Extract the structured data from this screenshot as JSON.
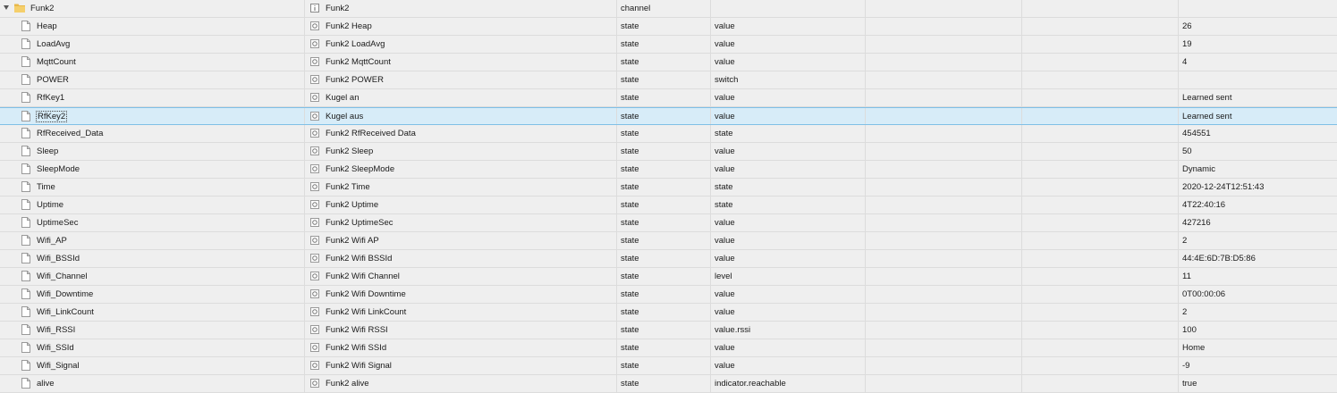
{
  "tree": {
    "parent": {
      "id": "Funk2",
      "name": "Funk2",
      "type": "channel",
      "role": "",
      "value": ""
    },
    "rows": [
      {
        "id": "Heap",
        "name": "Funk2 Heap",
        "type": "state",
        "role": "value",
        "value": "26"
      },
      {
        "id": "LoadAvg",
        "name": "Funk2 LoadAvg",
        "type": "state",
        "role": "value",
        "value": "19"
      },
      {
        "id": "MqttCount",
        "name": "Funk2 MqttCount",
        "type": "state",
        "role": "value",
        "value": "4"
      },
      {
        "id": "POWER",
        "name": "Funk2 POWER",
        "type": "state",
        "role": "switch",
        "value": ""
      },
      {
        "id": "RfKey1",
        "name": "Kugel an",
        "type": "state",
        "role": "value",
        "value": "Learned sent"
      },
      {
        "id": "RfKey2",
        "name": "Kugel aus",
        "type": "state",
        "role": "value",
        "value": "Learned sent",
        "selected": true
      },
      {
        "id": "RfReceived_Data",
        "name": "Funk2 RfReceived Data",
        "type": "state",
        "role": "state",
        "value": "454551"
      },
      {
        "id": "Sleep",
        "name": "Funk2 Sleep",
        "type": "state",
        "role": "value",
        "value": "50"
      },
      {
        "id": "SleepMode",
        "name": "Funk2 SleepMode",
        "type": "state",
        "role": "value",
        "value": "Dynamic"
      },
      {
        "id": "Time",
        "name": "Funk2 Time",
        "type": "state",
        "role": "state",
        "value": "2020-12-24T12:51:43"
      },
      {
        "id": "Uptime",
        "name": "Funk2 Uptime",
        "type": "state",
        "role": "state",
        "value": "4T22:40:16"
      },
      {
        "id": "UptimeSec",
        "name": "Funk2 UptimeSec",
        "type": "state",
        "role": "value",
        "value": "427216"
      },
      {
        "id": "Wifi_AP",
        "name": "Funk2 Wifi AP",
        "type": "state",
        "role": "value",
        "value": "2"
      },
      {
        "id": "Wifi_BSSId",
        "name": "Funk2 Wifi BSSId",
        "type": "state",
        "role": "value",
        "value": "44:4E:6D:7B:D5:86"
      },
      {
        "id": "Wifi_Channel",
        "name": "Funk2 Wifi Channel",
        "type": "state",
        "role": "level",
        "value": "11"
      },
      {
        "id": "Wifi_Downtime",
        "name": "Funk2 Wifi Downtime",
        "type": "state",
        "role": "value",
        "value": "0T00:00:06"
      },
      {
        "id": "Wifi_LinkCount",
        "name": "Funk2 Wifi LinkCount",
        "type": "state",
        "role": "value",
        "value": "2"
      },
      {
        "id": "Wifi_RSSI",
        "name": "Funk2 Wifi RSSI",
        "type": "state",
        "role": "value.rssi",
        "value": "100"
      },
      {
        "id": "Wifi_SSId",
        "name": "Funk2 Wifi SSId",
        "type": "state",
        "role": "value",
        "value": "Home"
      },
      {
        "id": "Wifi_Signal",
        "name": "Funk2 Wifi Signal",
        "type": "state",
        "role": "value",
        "value": "-9"
      },
      {
        "id": "alive",
        "name": "Funk2 alive",
        "type": "state",
        "role": "indicator.reachable",
        "value": "true"
      }
    ]
  },
  "icons": {
    "expander": "chevron-down-icon",
    "folder": "folder-icon",
    "channel": "channel-info-icon",
    "file": "file-icon",
    "state": "state-gear-icon"
  },
  "colors": {
    "selected_bg": "#d7ecf8",
    "selected_border": "#7fbfe6",
    "folder": "#e8b84a"
  }
}
